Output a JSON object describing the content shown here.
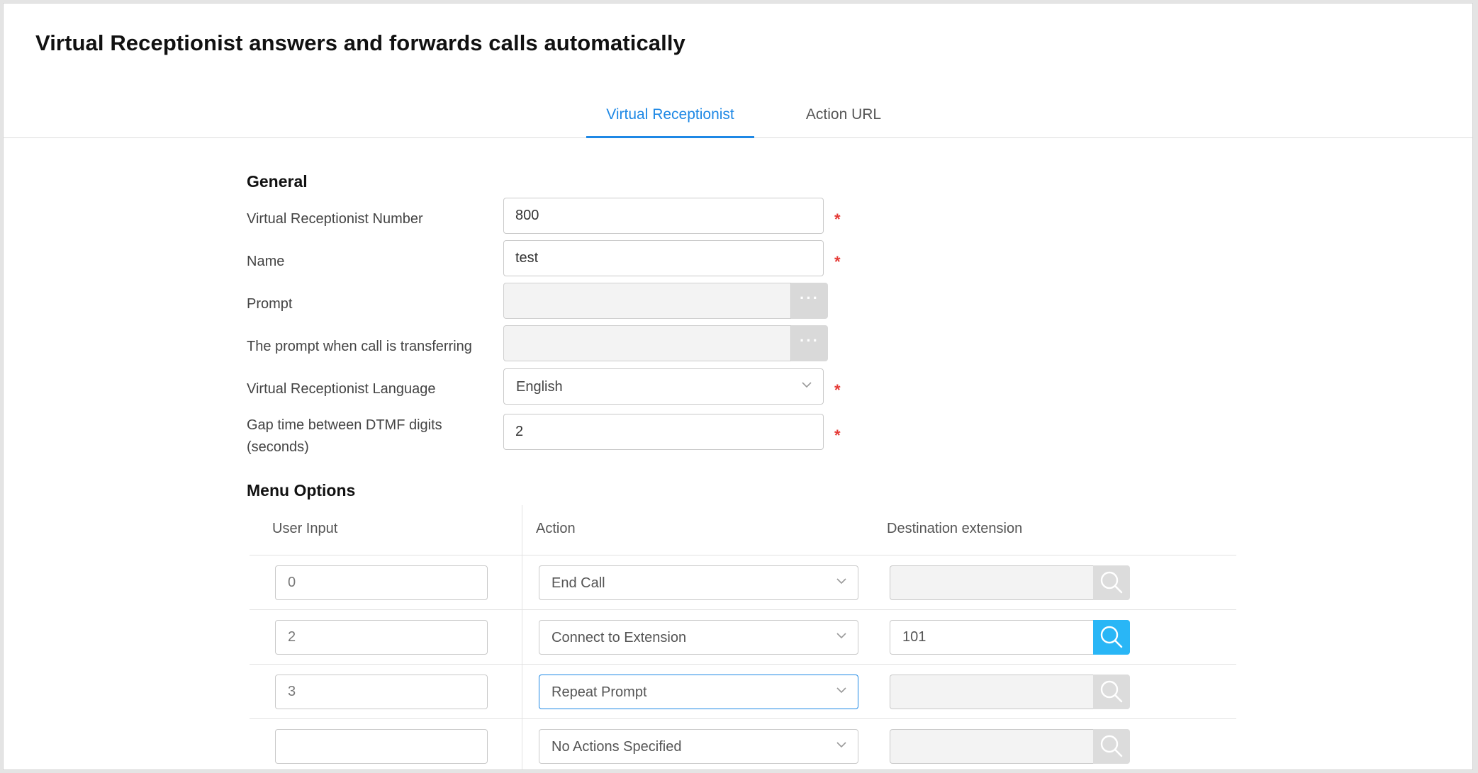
{
  "page": {
    "title": "Virtual Receptionist answers and forwards calls automatically"
  },
  "tabs": [
    {
      "label": "Virtual Receptionist",
      "active": true
    },
    {
      "label": "Action URL",
      "active": false
    }
  ],
  "general": {
    "heading": "General",
    "fields": {
      "number": {
        "label": "Virtual Receptionist Number",
        "value": "800",
        "required": true
      },
      "name": {
        "label": "Name",
        "value": "test",
        "required": true
      },
      "prompt": {
        "label": "Prompt",
        "value": "",
        "button": "···"
      },
      "transfer_prompt": {
        "label": "The prompt when call is transferring",
        "value": "",
        "button": "···"
      },
      "language": {
        "label": "Virtual Receptionist Language",
        "value": "English",
        "required": true
      },
      "dtmf_gap": {
        "label_line1": "Gap time between DTMF digits",
        "label_line2": "(seconds)",
        "value": "2",
        "required": true
      }
    },
    "required_marker": "*"
  },
  "menu_options": {
    "heading": "Menu Options",
    "columns": [
      "User Input",
      "Action",
      "Destination extension"
    ],
    "rows": [
      {
        "user_input": "0",
        "action": "End Call",
        "destination": "",
        "destination_enabled": false,
        "action_focused": false
      },
      {
        "user_input": "2",
        "action": "Connect to Extension",
        "destination": "101",
        "destination_enabled": true,
        "action_focused": false
      },
      {
        "user_input": "3",
        "action": "Repeat Prompt",
        "destination": "",
        "destination_enabled": false,
        "action_focused": true
      },
      {
        "user_input": "",
        "action": "No Actions Specified",
        "destination": "",
        "destination_enabled": false,
        "action_focused": false
      }
    ]
  },
  "icons": {
    "dropdown": "chevron-down-icon",
    "search": "search-icon",
    "browse": "more-icon"
  },
  "colors": {
    "accent": "#1e88e5",
    "search_active": "#29b6f6",
    "required": "#e53935"
  }
}
